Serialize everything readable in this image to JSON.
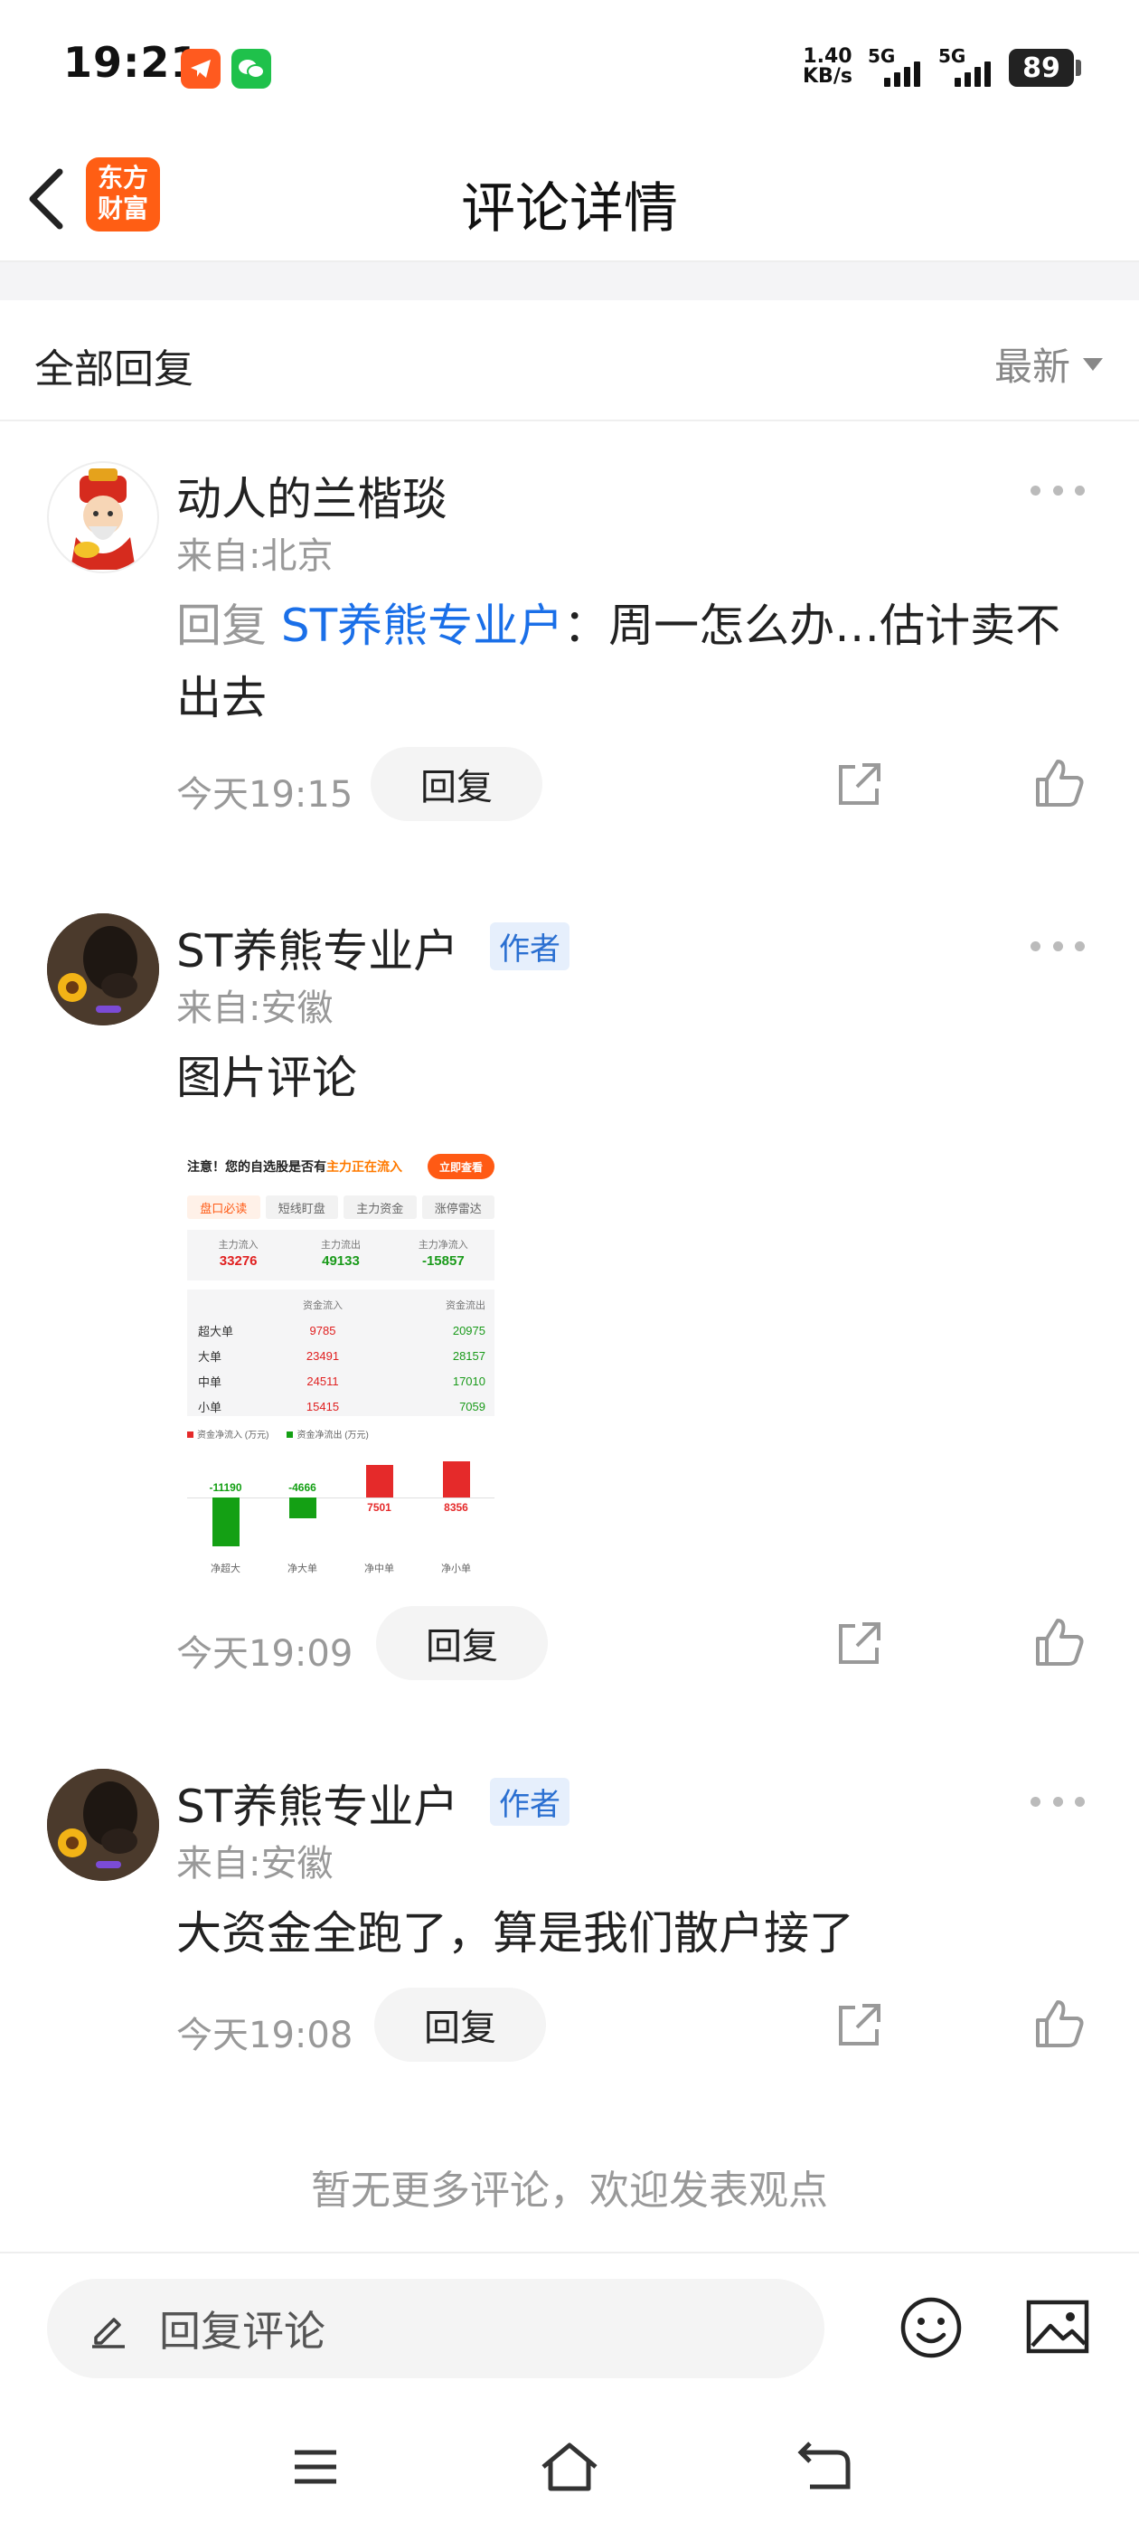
{
  "status_bar": {
    "time": "19:21",
    "net_speed_value": "1.40",
    "net_speed_unit": "KB/s",
    "signal_1": "5G",
    "signal_2": "5G",
    "battery": "89"
  },
  "nav": {
    "logo_line1": "东方",
    "logo_line2": "财富",
    "title": "评论详情"
  },
  "list_header": {
    "label": "全部回复",
    "sort": "最新"
  },
  "comments": [
    {
      "user": "动人的兰楷琰",
      "location": "来自:北京",
      "reply_prefix": "回复",
      "reply_target": "ST养熊专业户",
      "text": "：周一怎么办…估计卖不出去",
      "time": "今天19:15",
      "reply_label": "回复",
      "avatar": "god-of-wealth-avatar"
    },
    {
      "user": "ST养熊专业户",
      "tag": "作者",
      "location": "来自:安徽",
      "text": "图片评论",
      "time": "今天19:09",
      "reply_label": "回复",
      "avatar": "dog-avatar"
    },
    {
      "user": "ST养熊专业户",
      "tag": "作者",
      "location": "来自:安徽",
      "text": "大资金全跑了，算是我们散户接了",
      "time": "今天19:08",
      "reply_label": "回复",
      "avatar": "dog-avatar"
    }
  ],
  "image_comment": {
    "banner_prefix": "注意！您的自选股是否有",
    "banner_highlight": "主力正在流入",
    "banner_button": "立即查看",
    "tabs": [
      "盘口必读",
      "短线盯盘",
      "主力资金",
      "涨停雷达"
    ],
    "summary": [
      {
        "label": "主力流入",
        "value": "33276"
      },
      {
        "label": "主力流出",
        "value": "49133"
      },
      {
        "label": "主力净流入",
        "value": "-15857"
      }
    ],
    "table_headers": [
      "",
      "资金流入",
      "资金流出"
    ],
    "table_rows": [
      {
        "name": "超大单",
        "in": "9785",
        "out": "20975"
      },
      {
        "name": "大单",
        "in": "23491",
        "out": "28157"
      },
      {
        "name": "中单",
        "in": "24511",
        "out": "17010"
      },
      {
        "name": "小单",
        "in": "15415",
        "out": "7059"
      }
    ],
    "legend_in": "资金净流入 (万元)",
    "legend_out": "资金净流出 (万元)",
    "chart_data": {
      "type": "bar",
      "categories": [
        "净超大",
        "净大单",
        "净中单",
        "净小单"
      ],
      "values": [
        -11190,
        -4666,
        7501,
        8356
      ],
      "value_labels": [
        "-11190",
        "-4666",
        "7501",
        "8356"
      ],
      "colors": {
        "positive": "#e52a2a",
        "negative": "#14a014"
      }
    }
  },
  "footer": {
    "no_more": "暂无更多评论，欢迎发表观点",
    "input_placeholder": "回复评论"
  }
}
